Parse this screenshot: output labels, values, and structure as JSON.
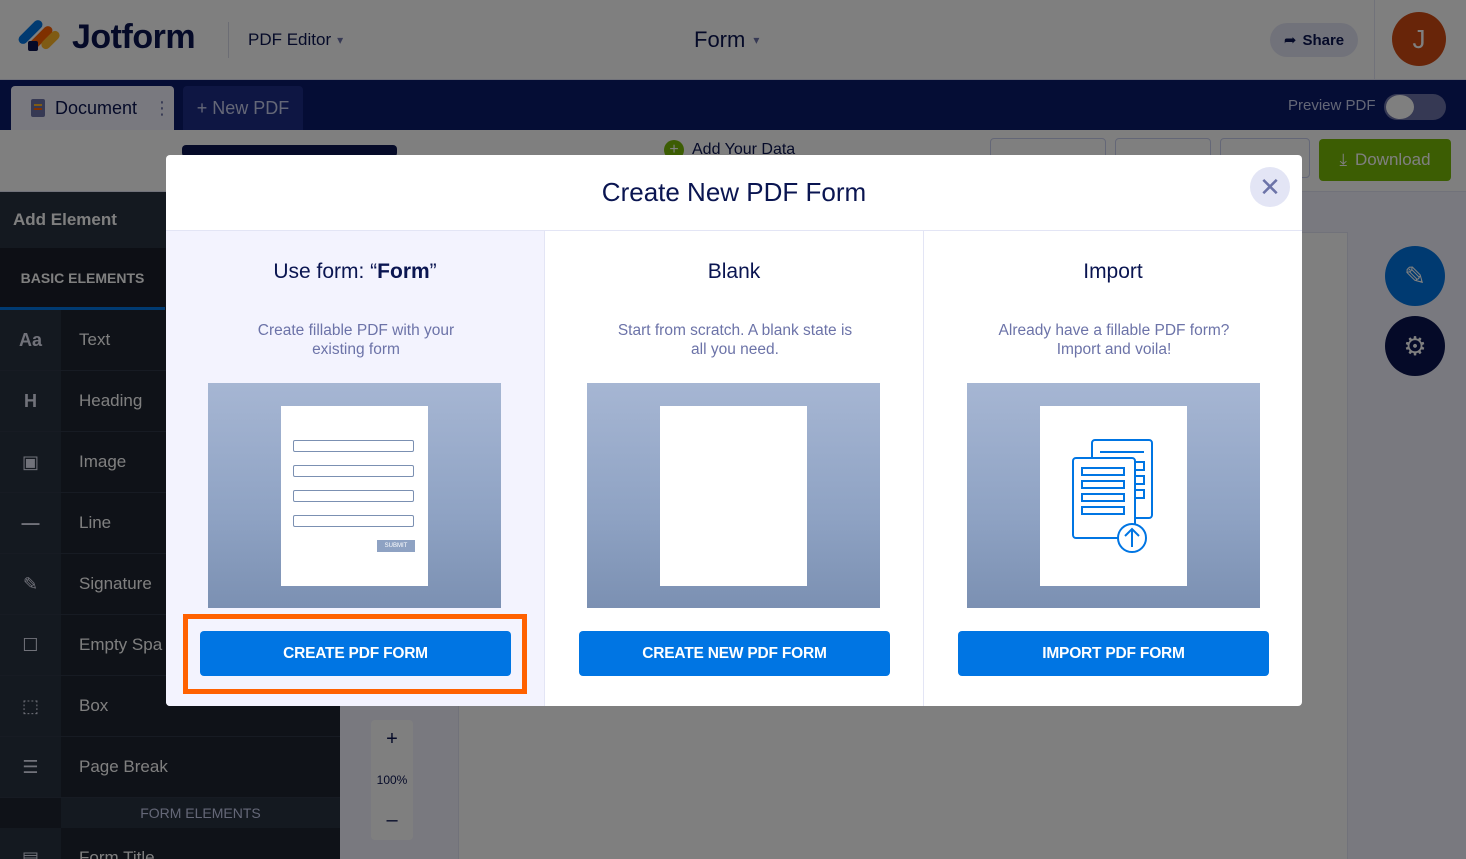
{
  "header": {
    "logo_text": "Jotform",
    "product": "PDF Editor",
    "form_name": "Form",
    "share_label": "Share",
    "avatar_initial": "J"
  },
  "navbar": {
    "document_tab": "Document",
    "new_pdf_tab": "+ New PDF",
    "preview_label": "Preview PDF"
  },
  "toolbar": {
    "add_data": "Add Your Data",
    "download_label": "Download"
  },
  "sidebar": {
    "title": "Add Element",
    "basic_tab": "BASIC ELEMENTS",
    "items": [
      {
        "icon": "Aa",
        "label": "Text"
      },
      {
        "icon": "H",
        "label": "Heading"
      },
      {
        "icon": "▣",
        "label": "Image"
      },
      {
        "icon": "—",
        "label": "Line"
      },
      {
        "icon": "✎",
        "label": "Signature"
      },
      {
        "icon": "☐",
        "label": "Empty Spa"
      },
      {
        "icon": "⬚",
        "label": "Box"
      },
      {
        "icon": "☰",
        "label": "Page Break"
      }
    ],
    "form_elements_section": "FORM ELEMENTS",
    "form_items": [
      {
        "icon": "▤",
        "label": "Form Title"
      }
    ]
  },
  "zoom": {
    "plus": "+",
    "level": "100%",
    "minus": "–"
  },
  "modal": {
    "title": "Create New PDF Form",
    "close_glyph": "✕",
    "options": [
      {
        "title_prefix": "Use form: “",
        "title_bold": "Form",
        "title_suffix": "”",
        "description": "Create fillable PDF with your existing form",
        "button": "CREATE PDF FORM",
        "mini_submit": "SUBMIT"
      },
      {
        "title": "Blank",
        "description": "Start from scratch. A blank state is all you need.",
        "button": "CREATE NEW PDF FORM"
      },
      {
        "title": "Import",
        "description": "Already have a fillable PDF form? Import and voila!",
        "button": "IMPORT PDF FORM"
      }
    ]
  },
  "colors": {
    "primary_blue": "#0075e3",
    "highlight_orange": "#ff6100",
    "navy": "#0a1551",
    "download_green": "#78bb07"
  },
  "icons": {
    "share": "share-arrow-icon",
    "close": "close-icon",
    "import": "document-upload-icon",
    "paint": "paint-roller-icon",
    "settings": "gear-icon"
  }
}
